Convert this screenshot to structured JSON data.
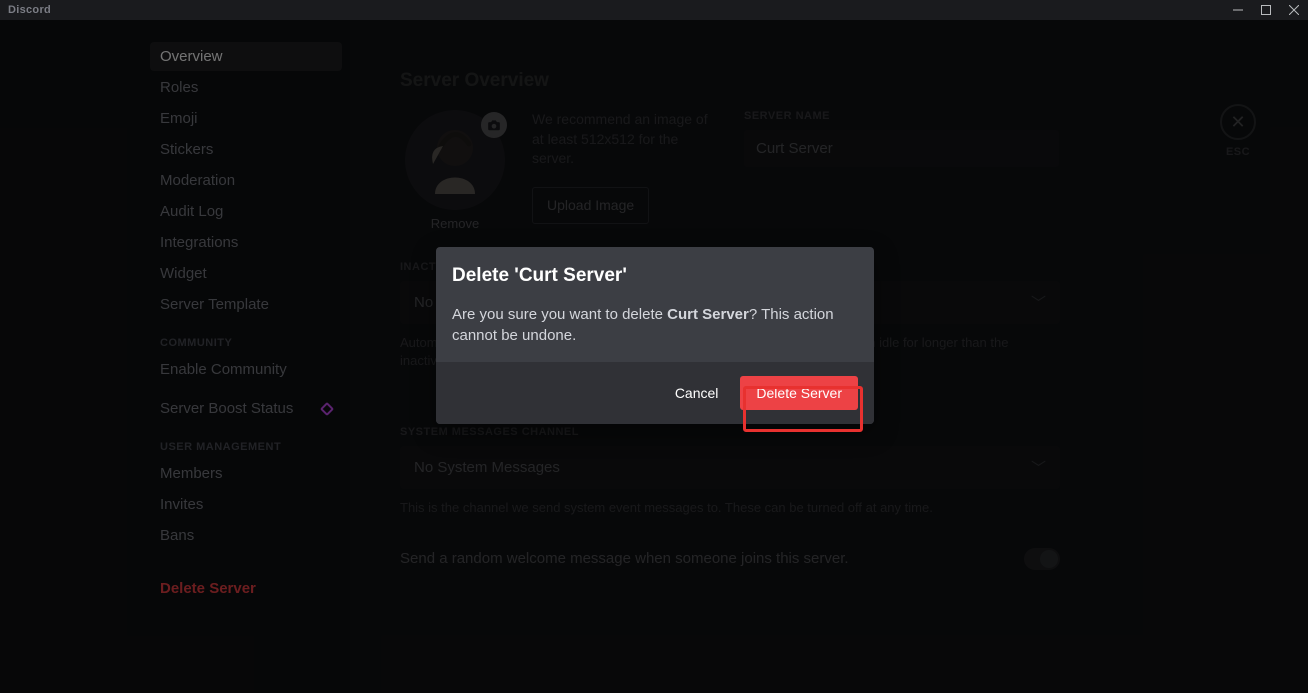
{
  "titlebar": {
    "brand": "Discord"
  },
  "sidebar": {
    "items": [
      {
        "label": "Overview",
        "selected": true
      },
      {
        "label": "Roles"
      },
      {
        "label": "Emoji"
      },
      {
        "label": "Stickers"
      },
      {
        "label": "Moderation"
      },
      {
        "label": "Audit Log"
      },
      {
        "label": "Integrations"
      },
      {
        "label": "Widget"
      },
      {
        "label": "Server Template"
      }
    ],
    "community_header": "COMMUNITY",
    "community_items": [
      {
        "label": "Enable Community"
      },
      {
        "label": "Server Boost Status",
        "boost": true
      }
    ],
    "user_mgmt_header": "USER MANAGEMENT",
    "user_mgmt_items": [
      {
        "label": "Members"
      },
      {
        "label": "Invites"
      },
      {
        "label": "Bans"
      }
    ],
    "delete_label": "Delete Server"
  },
  "content": {
    "page_title": "Server Overview",
    "recommend_text": "We recommend an image of at least 512x512 for the server.",
    "upload_btn": "Upload Image",
    "remove_link": "Remove",
    "server_name_label": "SERVER NAME",
    "server_name_value": "Curt Server",
    "inactive_label": "INACTIVE CHANNEL",
    "inactive_value": "No Inactive Channel",
    "inactive_helper": "Automatically move members to this channel and mute them when they have been idle for longer than the inactive timeout. This does not affect browsers.",
    "sys_label": "SYSTEM MESSAGES CHANNEL",
    "sys_value": "No System Messages",
    "sys_helper": "This is the channel we send system event messages to. These can be turned off at any time.",
    "welcome_toggle_text": "Send a random welcome message when someone joins this server.",
    "esc_label": "ESC"
  },
  "modal": {
    "title": "Delete 'Curt Server'",
    "body_prefix": "Are you sure you want to delete ",
    "body_bold": "Curt Server",
    "body_suffix": "? This action cannot be undone.",
    "cancel": "Cancel",
    "confirm": "Delete Server"
  }
}
